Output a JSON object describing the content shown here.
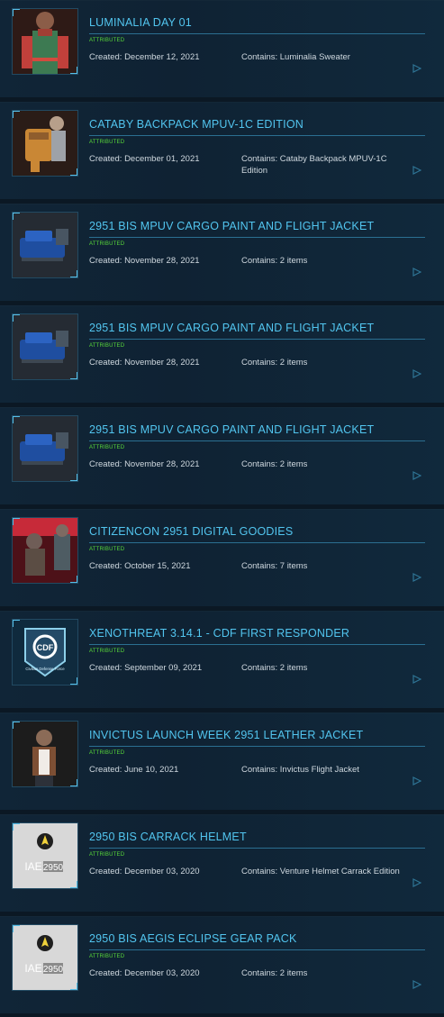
{
  "items": [
    {
      "title": "LUMINALIA DAY 01",
      "badge": "Attributed",
      "created": "Created: December 12, 2021",
      "contains": "Contains: Luminalia Sweater",
      "thumb": "sweater-image"
    },
    {
      "title": "CATABY BACKPACK MPUV-1C EDITION",
      "badge": "Attributed",
      "created": "Created: December 01, 2021",
      "contains": "Contains: Cataby Backpack MPUV-1C Edition",
      "thumb": "backpack-image"
    },
    {
      "title": "2951 BIS MPUV CARGO PAINT AND FLIGHT JACKET",
      "badge": "Attributed",
      "created": "Created: November 28, 2021",
      "contains": "Contains: 2 items",
      "thumb": "ship-image"
    },
    {
      "title": "2951 BIS MPUV CARGO PAINT AND FLIGHT JACKET",
      "badge": "Attributed",
      "created": "Created: November 28, 2021",
      "contains": "Contains: 2 items",
      "thumb": "ship-image"
    },
    {
      "title": "2951 BIS MPUV CARGO PAINT AND FLIGHT JACKET",
      "badge": "Attributed",
      "created": "Created: November 28, 2021",
      "contains": "Contains: 2 items",
      "thumb": "ship-image"
    },
    {
      "title": "CITIZENCON 2951 DIGITAL GOODIES",
      "badge": "Attributed",
      "created": "Created: October 15, 2021",
      "contains": "Contains: 7 items",
      "thumb": "character-image"
    },
    {
      "title": "XENOTHREAT 3.14.1 - CDF FIRST RESPONDER",
      "badge": "Attributed",
      "created": "Created: September 09, 2021",
      "contains": "Contains: 2 items",
      "thumb": "cdf-logo",
      "thumb_text": "Civilian Defense Force"
    },
    {
      "title": "INVICTUS LAUNCH WEEK 2951 LEATHER JACKET",
      "badge": "Attributed",
      "created": "Created: June 10, 2021",
      "contains": "Contains: Invictus Flight Jacket",
      "thumb": "jacket-image"
    },
    {
      "title": "2950 BIS CARRACK HELMET",
      "badge": "Attributed",
      "created": "Created: December 03, 2020",
      "contains": "Contains: Venture Helmet Carrack Edition",
      "thumb": "iae-logo",
      "thumb_text_a": "IAE",
      "thumb_text_b": "2950"
    },
    {
      "title": "2950 BIS AEGIS ECLIPSE GEAR PACK",
      "badge": "Attributed",
      "created": "Created: December 03, 2020",
      "contains": "Contains: 2 items",
      "thumb": "iae-logo",
      "thumb_text_a": "IAE",
      "thumb_text_b": "2950"
    }
  ],
  "icons": {
    "play": "play-icon"
  },
  "colors": {
    "accent": "#52c5ef",
    "badge": "#58d839"
  }
}
